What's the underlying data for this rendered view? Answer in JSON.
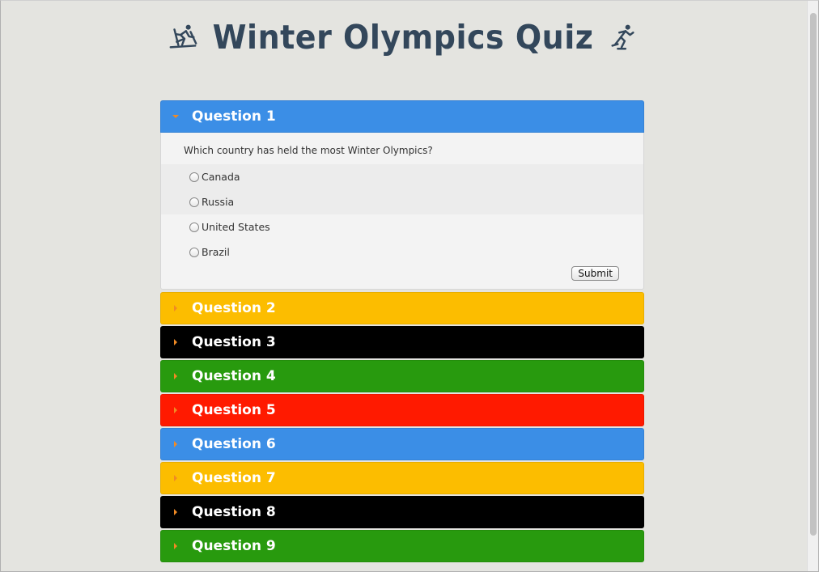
{
  "header": {
    "title": "Winter Olympics Quiz",
    "left_icon": "skier-icon",
    "right_icon": "skater-icon",
    "title_color": "#33475b"
  },
  "accordion": {
    "items": [
      {
        "label": "Question 1",
        "color": "#3b8ee6",
        "expanded": true
      },
      {
        "label": "Question 2",
        "color": "#fcbd00",
        "expanded": false
      },
      {
        "label": "Question 3",
        "color": "#000000",
        "expanded": false
      },
      {
        "label": "Question 4",
        "color": "#289a0e",
        "expanded": false
      },
      {
        "label": "Question 5",
        "color": "#ff1a00",
        "expanded": false
      },
      {
        "label": "Question 6",
        "color": "#3b8ee6",
        "expanded": false
      },
      {
        "label": "Question 7",
        "color": "#fcbd00",
        "expanded": false
      },
      {
        "label": "Question 8",
        "color": "#000000",
        "expanded": false
      },
      {
        "label": "Question 9",
        "color": "#289a0e",
        "expanded": false
      }
    ],
    "caret_color": "#f08a24"
  },
  "question1": {
    "text": "Which country has held the most Winter Olympics?",
    "options": [
      "Canada",
      "Russia",
      "United States",
      "Brazil"
    ],
    "submit_label": "Submit"
  }
}
